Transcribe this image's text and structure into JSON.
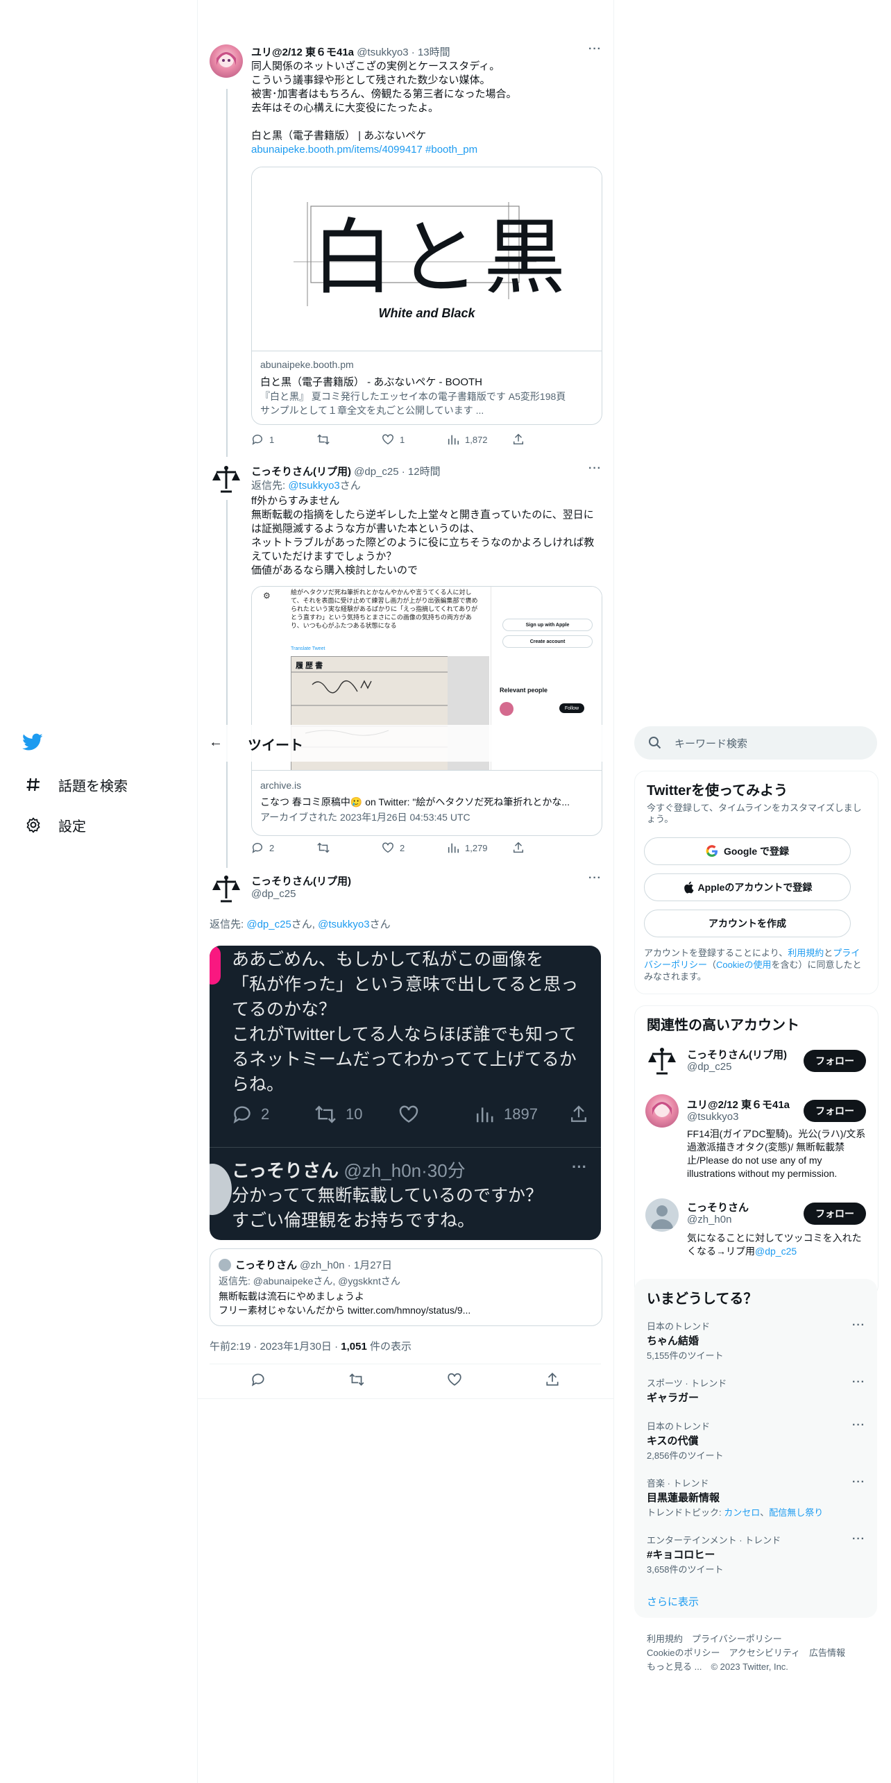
{
  "nav": {
    "explore_label": "話題を検索",
    "settings_label": "設定"
  },
  "header": {
    "title": "ツイート"
  },
  "search": {
    "placeholder": "キーワード検索"
  },
  "tweet1": {
    "name": "ユリ@2/12 東６モ41a",
    "handle": "@tsukkyo3",
    "time": "13時間",
    "text": "同人関係のネットいざこざの実例とケーススタディ。\nこういう議事録や形として残された数少ない媒体。\n被害･加害者はもちろん、傍観たる第三者になった場合。\n去年はその心構えに大変役にたったよ。\n\n白と黒（電子書籍版） | あぶないペケ",
    "link": "abunaipeke.booth.pm/items/4099417",
    "hashtag": "#booth_pm",
    "card": {
      "image_title": "白と黒",
      "image_subtitle": "White and Black",
      "domain": "abunaipeke.booth.pm",
      "title": "白と黒（電子書籍版） - あぶないペケ - BOOTH",
      "desc1": "『白と黒』 夏コミ発行したエッセイ本の電子書籍版です A5変形198頁",
      "desc2": "サンプルとして１章全文を丸ごと公開しています ..."
    },
    "replies": "1",
    "retweets": "",
    "likes": "1",
    "views": "1,872"
  },
  "tweet2": {
    "name": "こっそりさん(リプ用)",
    "handle": "@dp_c25",
    "time": "12時間",
    "reply_to_prefix": "返信先: ",
    "reply_to_handle": "@tsukkyo3",
    "reply_to_suffix": "さん",
    "text": "ff外からすみません\n無断転載の指摘をしたら逆ギレした上堂々と開き直っていたのに、翌日には証拠隠滅するような方が書いた本というのは、\nネットトラブルがあった際どのように役に立ちそうなのかよろしければ教えていただけますでしょうか？\n価値があるなら購入検討したいので",
    "card": {
      "shot_text": "絵がヘタクソだ死ね筆折れとかなんやかんや言うてくる人に対して、それを表面に受け止めて練習し画力が上がり出張編集部で褒められたという実な経験があるばかりに「えっ指摘してくれてありがとう直すわ」という気持ちとまさにこの画像の気持ちの両方があり、いつも心がふたつある状態になる",
      "shot_link": "Translate Tweet",
      "doc_title": "履 歴 書",
      "apple_btn": "Sign up with Apple",
      "create_btn": "Create account",
      "relevant": "Relevant people",
      "follow_small": "Follow",
      "domain": "archive.is",
      "title": "こなつ 春コミ原稿中🥲 on Twitter: \"絵がヘタクソだ死ね筆折れとかな...",
      "desc": "アーカイブされた 2023年1月26日 04:53:45 UTC"
    },
    "replies": "2",
    "retweets": "",
    "likes": "2",
    "views": "1,279"
  },
  "main_tweet": {
    "name": "こっそりさん(リプ用)",
    "handle": "@dp_c25",
    "reply_to_prefix": "返信先: ",
    "reply_to_handle1": "@dp_c25",
    "reply_to_mid": "さん, ",
    "reply_to_handle2": "@tsukkyo3",
    "reply_to_suffix": "さん",
    "image": {
      "text": "ああごめん、もしかして私がこの画像を\n「私が作った」という意味で出してると思ってるのかな？\nこれがTwitterしてる人ならほぼ誰でも知ってるネットミームだってわかってて上げてるからね。",
      "replies": "2",
      "retweets": "10",
      "views": "1897",
      "name2": "こっそりさん",
      "handle2": "@zh_h0n",
      "time2": "30分",
      "text2": "分かってて無断転載しているのですか？\nすごい倫理観をお持ちですね。"
    },
    "quote": {
      "name": "こっそりさん",
      "handle": "@zh_h0n",
      "date": "1月27日",
      "reply_prefix": "返信先: ",
      "reply_h1": "@abunaipeke",
      "reply_mid": "さん, ",
      "reply_h2": "@ygskkntさん",
      "text": "無断転載は流石にやめましょうよ\nフリー素材じゃないんだから twitter.com/hmnoy/status/9..."
    },
    "timestamp": "午前2:19 · 2023年1月30日 · ",
    "views_count": "1,051",
    "views_label": " 件の表示"
  },
  "signup": {
    "title": "Twitterを使ってみよう",
    "subtitle": "今すぐ登録して、タイムラインをカスタマイズしましょう。",
    "google_btn": "Google で登録",
    "apple_btn": "Appleのアカウントで登録",
    "create_btn": "アカウントを作成",
    "legal_1": "アカウントを登録することにより、",
    "legal_terms": "利用規約",
    "legal_2": "と",
    "legal_privacy": "プライバシーポリシー",
    "legal_3": "（",
    "legal_cookie": "Cookieの使用",
    "legal_4": "を含む）に同意したとみなされます。"
  },
  "related": {
    "title": "関連性の高いアカウント",
    "follow_label": "フォロー",
    "accounts": [
      {
        "name": "こっそりさん(リプ用)",
        "handle": "@dp_c25",
        "bio": ""
      },
      {
        "name": "ユリ@2/12 東６モ41a",
        "handle": "@tsukkyo3",
        "bio": "FF14泪(ガイアDC聖騎)。光公(ラハ)/文系過激派描きオタク(変態)/ 無断転載禁止/Please do not use any of my illustrations without my permission."
      },
      {
        "name": "こっそりさん",
        "handle": "@zh_h0n",
        "bio": "気になることに対してツッコミを入れたくなる→リプ用",
        "bio_link": "@dp_c25"
      }
    ]
  },
  "trends": {
    "title": "いまどうしてる？",
    "items": [
      {
        "category": "日本のトレンド",
        "name": "ちゃん結婚",
        "count": "5,155件のツイート"
      },
      {
        "category": "スポーツ · トレンド",
        "name": "ギャラガー",
        "count": ""
      },
      {
        "category": "日本のトレンド",
        "name": "キスの代償",
        "count": "2,856件のツイート"
      },
      {
        "category": "音楽 · トレンド",
        "name": "目黒蓮最新情報",
        "count": "トレンドトピック: ",
        "topic1": "カンセロ",
        "topic_sep": "、",
        "topic2": "配信無し祭り"
      },
      {
        "category": "エンターテインメント · トレンド",
        "name": "#キョコロヒー",
        "count": "3,658件のツイート"
      }
    ],
    "show_more": "さらに表示"
  },
  "footer": {
    "line1": "利用規約　プライバシーポリシー",
    "line2": "Cookieのポリシー　アクセシビリティ　広告情報",
    "line3": "もっと見る ...　© 2023 Twitter, Inc."
  },
  "colors": {
    "accent": "#1d9bf0",
    "text": "#0f1419",
    "muted": "#536471",
    "dark_card": "#15202b"
  }
}
